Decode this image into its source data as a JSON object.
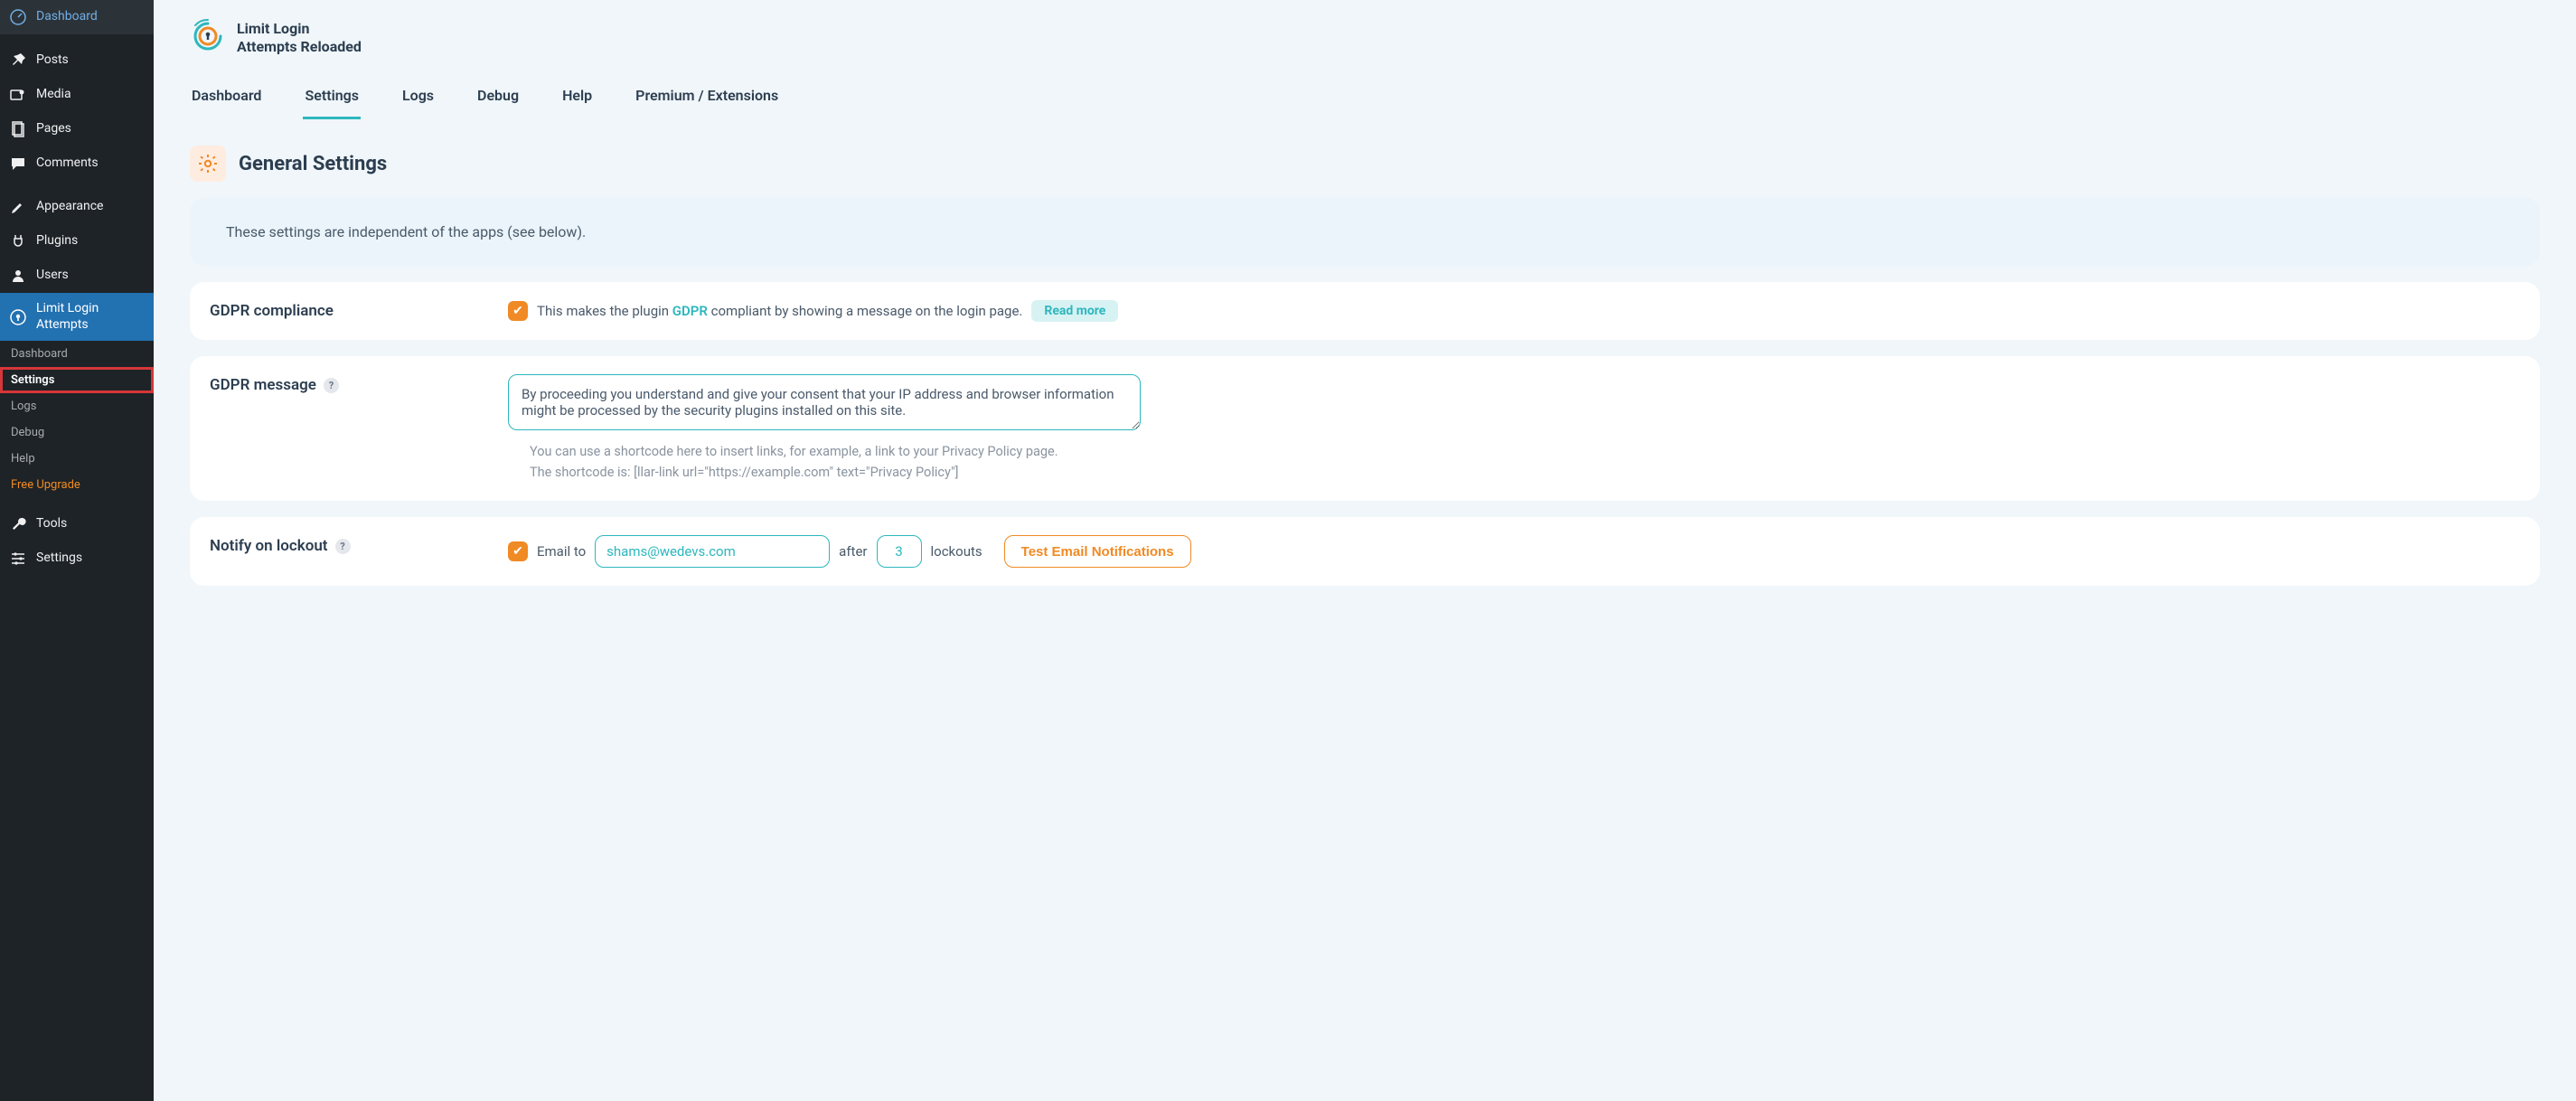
{
  "wp_sidebar": {
    "items": [
      {
        "label": "Dashboard",
        "icon": "dashboard"
      },
      {
        "label": "Posts",
        "icon": "pin"
      },
      {
        "label": "Media",
        "icon": "media"
      },
      {
        "label": "Pages",
        "icon": "page"
      },
      {
        "label": "Comments",
        "icon": "comment"
      },
      {
        "label": "Appearance",
        "icon": "brush"
      },
      {
        "label": "Plugins",
        "icon": "plug"
      },
      {
        "label": "Users",
        "icon": "user"
      },
      {
        "label": "Limit Login Attempts",
        "icon": "shield",
        "active": true
      },
      {
        "label": "Tools",
        "icon": "wrench"
      },
      {
        "label": "Settings",
        "icon": "sliders"
      }
    ],
    "submenu": [
      {
        "label": "Dashboard"
      },
      {
        "label": "Settings",
        "active": true,
        "highlighted": true
      },
      {
        "label": "Logs"
      },
      {
        "label": "Debug"
      },
      {
        "label": "Help"
      },
      {
        "label": "Free Upgrade",
        "orange": true
      }
    ]
  },
  "brand": {
    "line1": "Limit Login",
    "line2": "Attempts Reloaded"
  },
  "tabs": [
    {
      "label": "Dashboard"
    },
    {
      "label": "Settings",
      "active": true
    },
    {
      "label": "Logs"
    },
    {
      "label": "Debug"
    },
    {
      "label": "Help"
    },
    {
      "label": "Premium / Extensions"
    }
  ],
  "section": {
    "title": "General Settings",
    "info": "These settings are independent of the apps (see below)."
  },
  "gdpr": {
    "label": "GDPR compliance",
    "desc_before": "This makes the plugin ",
    "desc_link": "GDPR",
    "desc_after": " compliant by showing a message on the login page.",
    "read_more": "Read more"
  },
  "gdpr_message": {
    "label": "GDPR message",
    "value": "By proceeding you understand and give your consent that your IP address and browser information might be processed by the security plugins installed on this site.",
    "hint1": "You can use a shortcode here to insert links, for example, a link to your Privacy Policy page.",
    "hint2": "The shortcode is: [llar-link url=\"https://example.com\" text=\"Privacy Policy\"]"
  },
  "notify": {
    "label": "Notify on lockout",
    "email_to": "Email to",
    "email_value": "shams@wedevs.com",
    "after": "after",
    "lockouts_value": "3",
    "lockouts": "lockouts",
    "test_button": "Test Email Notifications"
  }
}
